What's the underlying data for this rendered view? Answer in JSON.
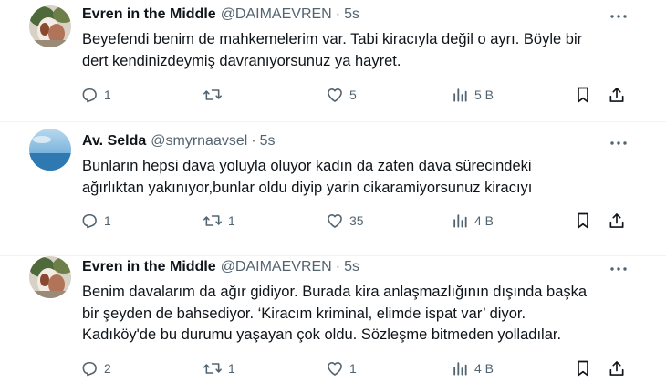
{
  "tweets": [
    {
      "name": "Evren in the Middle",
      "handle": "@DAIMAEVREN",
      "separator": "·",
      "time": "5s",
      "lines": [
        "Beyefendi benim de mahkemelerim var. Tabi kiracıyla değil o ayrı. Böyle bir",
        "dert kendinizdeymiş davranıyorsunuz ya hayret."
      ],
      "replies": "1",
      "retweets": "",
      "likes": "5",
      "views": "5 B"
    },
    {
      "name": "Av. Selda",
      "handle": "@smyrnaavsel",
      "separator": "·",
      "time": "5s",
      "lines": [
        "Bunların hepsi dava yoluyla oluyor kadın da zaten dava sürecindeki",
        "ağırlıktan yakınıyor,bunlar oldu diyip yarin cikaramiyorsunuz kiracıyı"
      ],
      "replies": "1",
      "retweets": "1",
      "likes": "35",
      "views": "4 B"
    },
    {
      "name": "Evren in the Middle",
      "handle": "@DAIMAEVREN",
      "separator": "·",
      "time": "5s",
      "lines": [
        "Benim davalarım da ağır gidiyor. Burada kira anlaşmazlığının dışında başka",
        "bir şeyden de bahsediyor. ‘Kiracım kriminal, elimde ispat var’ diyor.",
        "Kadıköy'de bu durumu yaşayan çok oldu. Sözleşme bitmeden yolladılar."
      ],
      "replies": "2",
      "retweets": "1",
      "likes": "1",
      "views": "4 B"
    }
  ],
  "colors": {
    "text": "#0f1419",
    "secondary": "#536471",
    "divider": "#eff3f4"
  },
  "icons": [
    "reply-icon",
    "retweet-icon",
    "like-icon",
    "views-icon",
    "bookmark-icon",
    "share-icon",
    "more-icon"
  ]
}
